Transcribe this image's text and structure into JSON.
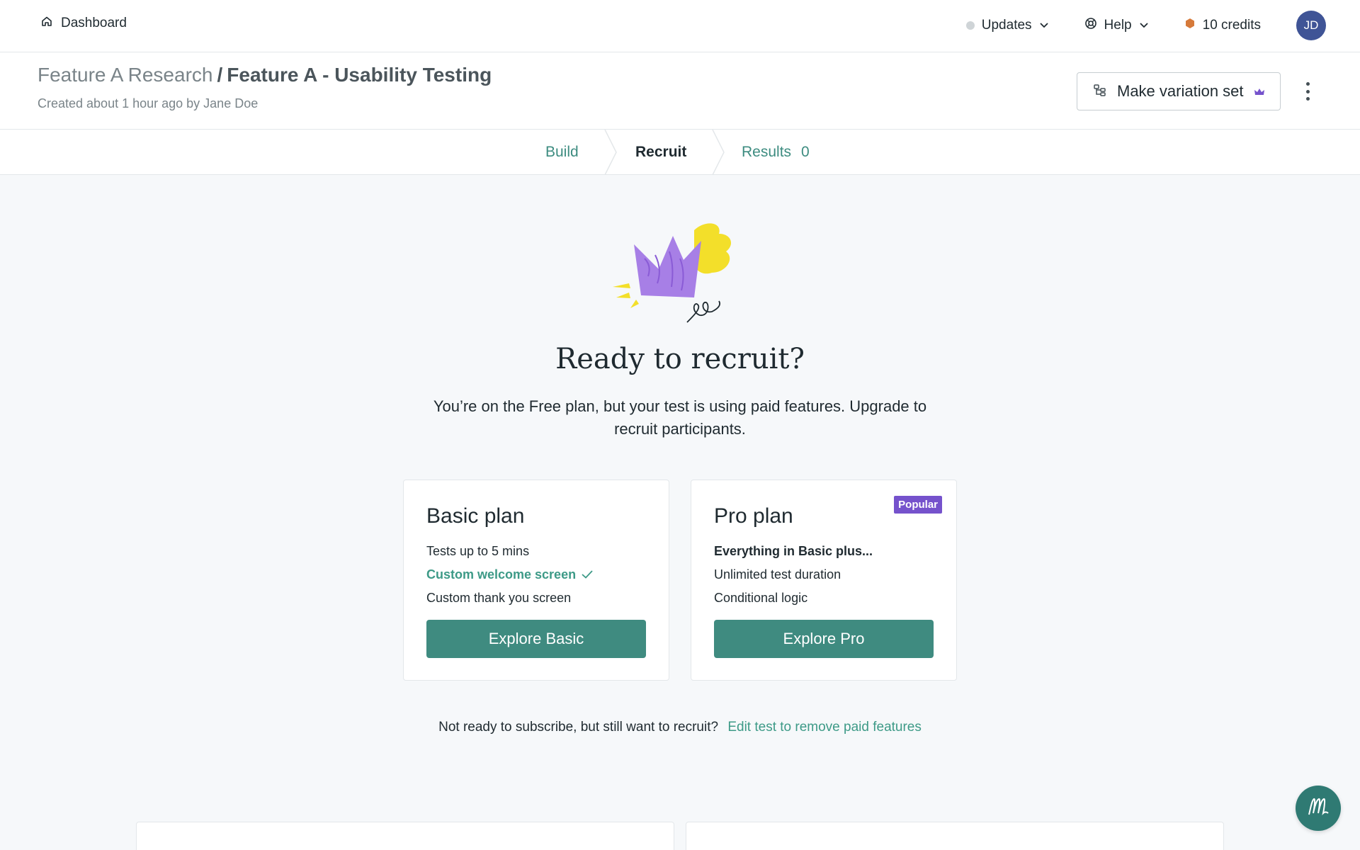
{
  "nav": {
    "dashboard_label": "Dashboard",
    "updates_label": "Updates",
    "help_label": "Help",
    "credits_label": "10 credits",
    "avatar_initials": "JD",
    "credits_dot_color": "#d67a3a",
    "updates_dot_color": "#cfd4d7"
  },
  "header": {
    "breadcrumb_parent": "Feature A Research",
    "breadcrumb_separator": "/",
    "breadcrumb_current": "Feature A - Usability Testing",
    "created_text": "Created about 1 hour ago by Jane Doe",
    "variation_button_label": "Make variation set"
  },
  "tabs": {
    "build": "Build",
    "recruit": "Recruit",
    "results": "Results",
    "results_count": "0",
    "active": "Recruit"
  },
  "main": {
    "title": "Ready to recruit?",
    "subtitle": "You’re on the Free plan, but your test is using paid features. Upgrade to recruit participants."
  },
  "plans": {
    "basic": {
      "title": "Basic plan",
      "features": [
        "Tests up to 5 mins",
        "Custom welcome screen",
        "Custom thank you screen"
      ],
      "button": "Explore Basic"
    },
    "pro": {
      "title": "Pro plan",
      "badge": "Popular",
      "features": [
        "Everything in Basic plus...",
        "Unlimited test duration",
        "Conditional logic"
      ],
      "button": "Explore Pro"
    }
  },
  "footer": {
    "prompt": "Not ready to subscribe, but still want to recruit?",
    "link": "Edit test to remove paid features"
  },
  "colors": {
    "accent_teal": "#3f8b80",
    "link_teal": "#3d9a87",
    "badge_purple": "#7552cc",
    "avatar_blue": "#3f5496"
  }
}
